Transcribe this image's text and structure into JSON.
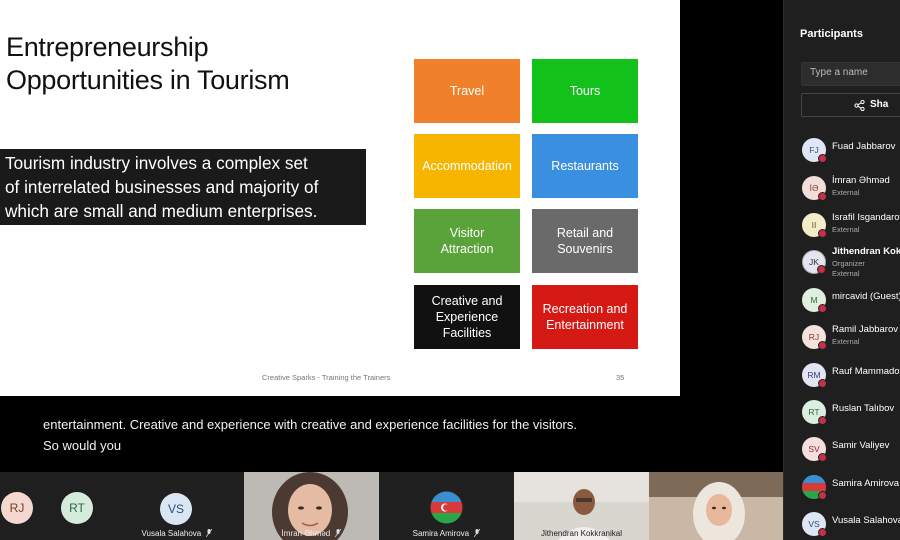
{
  "slide": {
    "title_line1": "Entrepreneurship",
    "title_line2": "Opportunities in Tourism",
    "text_line1": "Tourism industry involves a complex set",
    "text_line2": "of interrelated businesses and majority of",
    "text_line3": "which are small and medium enterprises.",
    "tiles": [
      {
        "line1": "Travel",
        "line2": "",
        "color": "#f08029"
      },
      {
        "line1": "Tours",
        "line2": "",
        "color": "#12c21b"
      },
      {
        "line1": "Accommodation",
        "line2": "",
        "color": "#f7b500"
      },
      {
        "line1": "Restaurants",
        "line2": "",
        "color": "#3b8fe0"
      },
      {
        "line1": "Visitor",
        "line2": "Attraction",
        "color": "#5aa33b"
      },
      {
        "line1": "Retail and",
        "line2": "Souvenirs",
        "color": "#6a6a6a"
      },
      {
        "line1": "Creative and",
        "line2": "Experience",
        "line3": "Facilities",
        "color": "#111111"
      },
      {
        "line1": "Recreation and",
        "line2": "Entertainment",
        "color": "#d51a15"
      }
    ],
    "footer": "Creative Sparks - Training the Trainers",
    "page_number": "35"
  },
  "caption": {
    "line1": "entertainment. Creative and experience with creative and experience facilities for the visitors.",
    "line2": "So would you"
  },
  "strip": {
    "rj_initials": "RJ",
    "rt_initials": "RT",
    "vs_initials": "VS",
    "vusala_name": "Vusala Salahova",
    "imran_name": "İmran Əhməd",
    "samira_name": "Samira Amirova",
    "jithendran_name": "Jithendran Kokkranikal"
  },
  "panel": {
    "title": "Participants",
    "search_placeholder": "Type a name",
    "share_label": "Sha",
    "participants": [
      {
        "initials": "FJ",
        "name": "Fuad Jabbarov",
        "sub1": "",
        "sub2": "",
        "avatar_color": "#dfe6f5"
      },
      {
        "initials": "İƏ",
        "name": "İmran Əhməd",
        "sub1": "External",
        "sub2": "",
        "avatar_color": "#f3ddd9"
      },
      {
        "initials": "II",
        "name": "Israfil Isgandarov",
        "sub1": "External",
        "sub2": "",
        "avatar_color": "#f3ecc9"
      },
      {
        "initials": "JK",
        "name": "Jithendran Kokkranikal",
        "sub1": "Organizer",
        "sub2": "External",
        "avatar_color": "#e3e6f0"
      },
      {
        "initials": "M",
        "name": "mircavid (Guest)",
        "sub1": "",
        "sub2": "",
        "avatar_color": "#dfeede"
      },
      {
        "initials": "RJ",
        "name": "Ramil Jabbarov",
        "sub1": "External",
        "sub2": "",
        "avatar_color": "#f5e2dc"
      },
      {
        "initials": "RM",
        "name": "Rauf Mammadov",
        "sub1": "",
        "sub2": "",
        "avatar_color": "#e2e4f2"
      },
      {
        "initials": "RT",
        "name": "Ruslan Talıbov",
        "sub1": "",
        "sub2": "",
        "avatar_color": "#dbeee2"
      },
      {
        "initials": "SV",
        "name": "Samir Valiyev",
        "sub1": "",
        "sub2": "",
        "avatar_color": "#f6dede"
      },
      {
        "initials": "",
        "name": "Samira Amirova",
        "sub1": "",
        "sub2": "",
        "avatar_color": "#3a6fb0"
      },
      {
        "initials": "VS",
        "name": "Vusala Salahova",
        "sub1": "",
        "sub2": "",
        "avatar_color": "#dde7f3"
      }
    ]
  }
}
